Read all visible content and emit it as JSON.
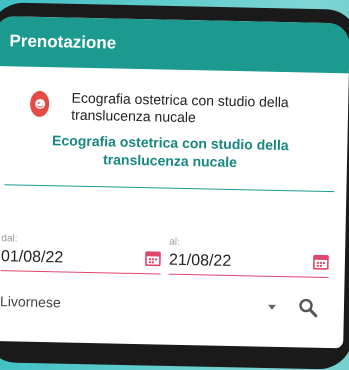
{
  "appbar": {
    "title": "Prenotazione"
  },
  "exam": {
    "name": "Ecografia ostetrica con studio della translucenza nucale",
    "title": "Ecografia ostetrica con studio della translucenza nucale",
    "icon": "baby-icon"
  },
  "dates": {
    "from": {
      "label": "dal:",
      "value": "01/08/22"
    },
    "to": {
      "label": "al:",
      "value": "21/08/22"
    }
  },
  "location": {
    "value": "Livornese"
  },
  "colors": {
    "primary": "#1c9a90",
    "accent": "#e0456b",
    "icon_red": "#e64a45"
  }
}
